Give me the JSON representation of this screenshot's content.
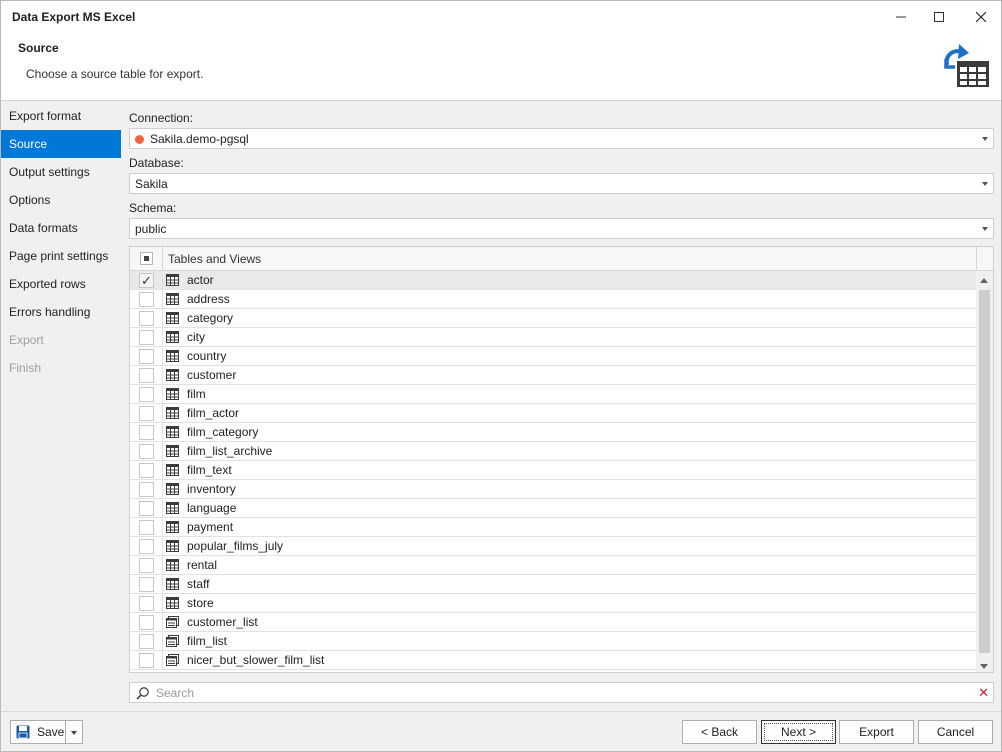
{
  "window": {
    "title": "Data Export MS Excel"
  },
  "header": {
    "title": "Source",
    "subtitle": "Choose a source table for export."
  },
  "sidebar": {
    "items": [
      {
        "label": "Export format",
        "state": "normal"
      },
      {
        "label": "Source",
        "state": "active"
      },
      {
        "label": "Output settings",
        "state": "normal"
      },
      {
        "label": "Options",
        "state": "normal"
      },
      {
        "label": "Data formats",
        "state": "normal"
      },
      {
        "label": "Page print settings",
        "state": "normal"
      },
      {
        "label": "Exported rows",
        "state": "normal"
      },
      {
        "label": "Errors handling",
        "state": "normal"
      },
      {
        "label": "Export",
        "state": "disabled"
      },
      {
        "label": "Finish",
        "state": "disabled"
      }
    ]
  },
  "form": {
    "connection": {
      "label": "Connection:",
      "value": "Sakila.demo-pgsql",
      "status_color": "#f0653f"
    },
    "database": {
      "label": "Database:",
      "value": "Sakila"
    },
    "schema": {
      "label": "Schema:",
      "value": "public"
    }
  },
  "grid": {
    "column_header": "Tables and Views",
    "rows": [
      {
        "name": "actor",
        "checked": true,
        "kind": "table"
      },
      {
        "name": "address",
        "checked": false,
        "kind": "table"
      },
      {
        "name": "category",
        "checked": false,
        "kind": "table"
      },
      {
        "name": "city",
        "checked": false,
        "kind": "table"
      },
      {
        "name": "country",
        "checked": false,
        "kind": "table"
      },
      {
        "name": "customer",
        "checked": false,
        "kind": "table"
      },
      {
        "name": "film",
        "checked": false,
        "kind": "table"
      },
      {
        "name": "film_actor",
        "checked": false,
        "kind": "table"
      },
      {
        "name": "film_category",
        "checked": false,
        "kind": "table"
      },
      {
        "name": "film_list_archive",
        "checked": false,
        "kind": "table"
      },
      {
        "name": "film_text",
        "checked": false,
        "kind": "table"
      },
      {
        "name": "inventory",
        "checked": false,
        "kind": "table"
      },
      {
        "name": "language",
        "checked": false,
        "kind": "table"
      },
      {
        "name": "payment",
        "checked": false,
        "kind": "table"
      },
      {
        "name": "popular_films_july",
        "checked": false,
        "kind": "table"
      },
      {
        "name": "rental",
        "checked": false,
        "kind": "table"
      },
      {
        "name": "staff",
        "checked": false,
        "kind": "table"
      },
      {
        "name": "store",
        "checked": false,
        "kind": "table"
      },
      {
        "name": "customer_list",
        "checked": false,
        "kind": "view"
      },
      {
        "name": "film_list",
        "checked": false,
        "kind": "view"
      },
      {
        "name": "nicer_but_slower_film_list",
        "checked": false,
        "kind": "view"
      }
    ]
  },
  "search": {
    "placeholder": "Search",
    "value": ""
  },
  "footer": {
    "save_label": "Save",
    "back_label": "< Back",
    "next_label": "Next >",
    "export_label": "Export",
    "cancel_label": "Cancel"
  },
  "icons": {
    "minimize": "minimize-icon",
    "maximize": "maximize-icon",
    "close": "close-icon",
    "header": "export-table-icon",
    "table": "table-icon",
    "view": "view-icon",
    "search": "search-icon",
    "clear": "clear-icon",
    "save": "save-icon"
  },
  "colors": {
    "accent": "#0078d7",
    "clear": "#c0262d"
  }
}
